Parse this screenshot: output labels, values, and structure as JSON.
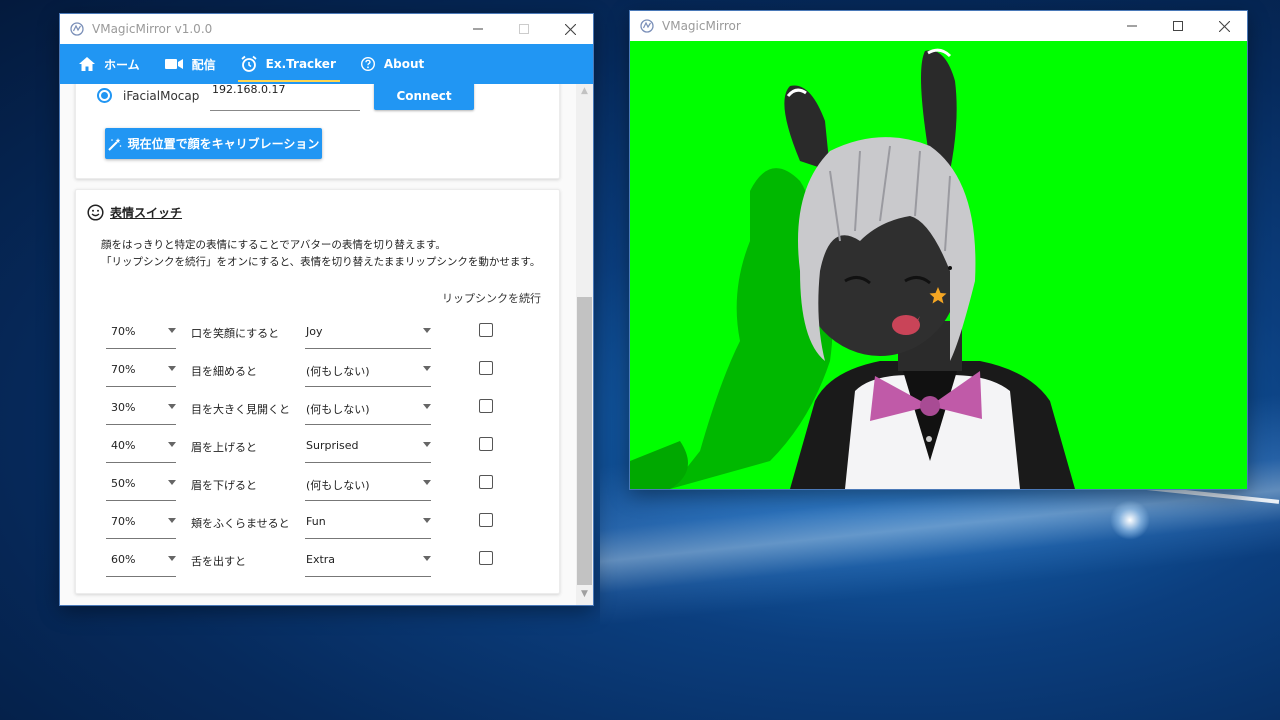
{
  "settings_window": {
    "title": "VMagicMirror v1.0.0",
    "tabs": [
      {
        "label": "ホーム",
        "icon": "home-icon"
      },
      {
        "label": "配信",
        "icon": "video-camera-icon"
      },
      {
        "label": "Ex.Tracker",
        "icon": "alarm-clock-icon",
        "active": true
      },
      {
        "label": "About",
        "icon": "help-circle-icon"
      }
    ],
    "tracker": {
      "source_label": "iFacialMocap",
      "ip_value": "192.168.0.17",
      "connect_label": "Connect",
      "calibrate_label": "現在位置で顔をキャリブレーション",
      "calibrate_icon": "magic-wand-icon"
    },
    "expression_switch": {
      "title": "表情スイッチ",
      "icon": "smiley-icon",
      "description_1": "顔をはっきりと特定の表情にすることでアバターの表情を切り替えます。",
      "description_2": "「リップシンクを続行」をオンにすると、表情を切り替えたままリップシンクを動かせます。",
      "lipsync_header": "リップシンクを続行",
      "rows": [
        {
          "threshold": "70%",
          "condition": "口を笑顔にすると",
          "expression": "Joy",
          "lipsync": false
        },
        {
          "threshold": "70%",
          "condition": "目を細めると",
          "expression": "(何もしない)",
          "lipsync": false
        },
        {
          "threshold": "30%",
          "condition": "目を大きく見開くと",
          "expression": "(何もしない)",
          "lipsync": false
        },
        {
          "threshold": "40%",
          "condition": "眉を上げると",
          "expression": "Surprised",
          "lipsync": false
        },
        {
          "threshold": "50%",
          "condition": "眉を下げると",
          "expression": "(何もしない)",
          "lipsync": false
        },
        {
          "threshold": "70%",
          "condition": "頬をふくらませると",
          "expression": "Fun",
          "lipsync": false
        },
        {
          "threshold": "60%",
          "condition": "舌を出すと",
          "expression": "Extra",
          "lipsync": false
        }
      ]
    }
  },
  "preview_window": {
    "title": "VMagicMirror",
    "background_color": "#00ff00"
  },
  "colors": {
    "accent": "#2196f3",
    "active_tab_underline": "#ffd54f"
  }
}
